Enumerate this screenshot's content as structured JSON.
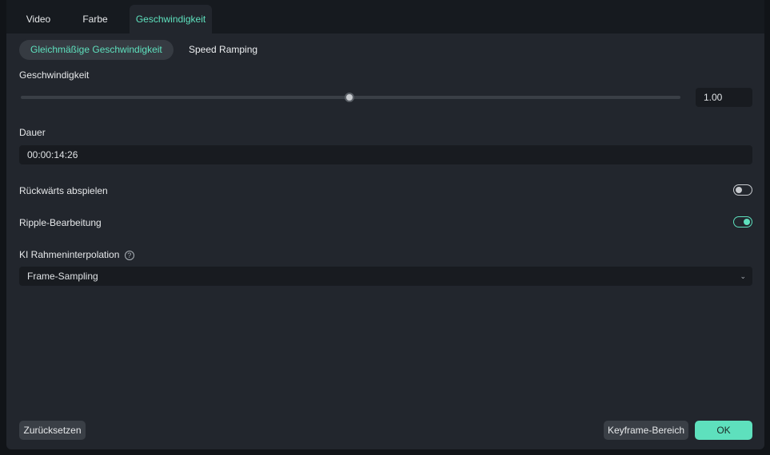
{
  "tabs": [
    {
      "label": "Video"
    },
    {
      "label": "Farbe"
    },
    {
      "label": "Geschwindigkeit",
      "active": true
    }
  ],
  "mode_tabs": [
    {
      "label": "Gleichmäßige Geschwindigkeit",
      "active": true
    },
    {
      "label": "Speed Ramping"
    }
  ],
  "speed": {
    "label": "Geschwindigkeit",
    "value": "1.00",
    "slider_fraction": 0.5
  },
  "duration": {
    "label": "Dauer",
    "value": "00:00:14:26"
  },
  "reverse": {
    "label": "Rückwärts abspielen",
    "on": false
  },
  "ripple": {
    "label": "Ripple-Bearbeitung",
    "on": true
  },
  "interpolation": {
    "label": "KI Rahmeninterpolation",
    "help_icon": "question-circle-icon",
    "selected": "Frame-Sampling"
  },
  "footer": {
    "reset": "Zurücksetzen",
    "keyframe": "Keyframe-Bereich",
    "ok": "OK"
  },
  "colors": {
    "accent": "#5ee0bd",
    "panel": "#22262d",
    "field": "#181b20"
  }
}
